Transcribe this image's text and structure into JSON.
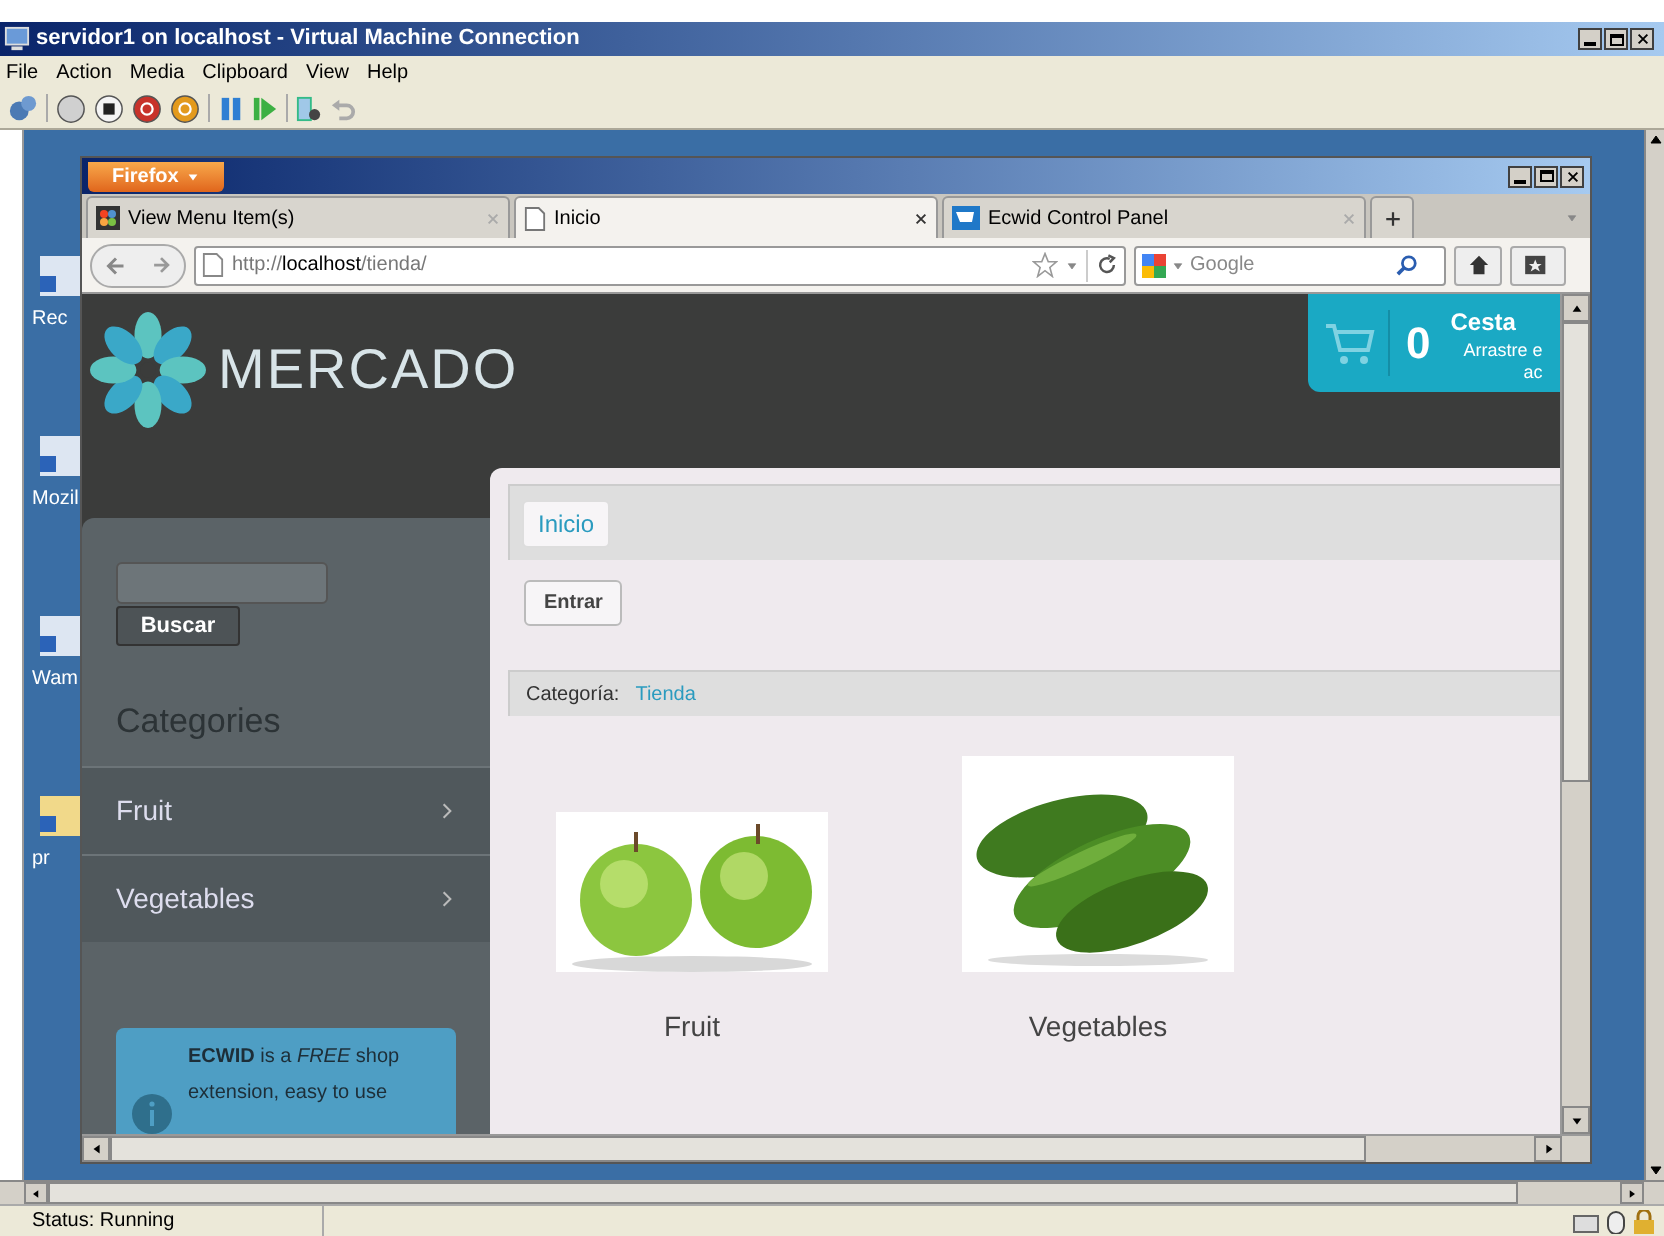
{
  "vm_window": {
    "title": "servidor1 on localhost - Virtual Machine Connection",
    "menu": [
      "File",
      "Action",
      "Media",
      "Clipboard",
      "View",
      "Help"
    ],
    "status": "Status: Running"
  },
  "desktop_icons": [
    {
      "label": "Rec"
    },
    {
      "label": "Mozil"
    },
    {
      "label": "Wam"
    },
    {
      "label": "pr"
    }
  ],
  "browser": {
    "menu_button": "Firefox",
    "tabs": [
      {
        "label": "View Menu Item(s)",
        "selected": false
      },
      {
        "label": "Inicio",
        "selected": true
      },
      {
        "label": "Ecwid Control Panel",
        "selected": false
      }
    ],
    "url": {
      "scheme": "http://",
      "host": "localhost",
      "path": "/tienda/"
    },
    "search_placeholder": "Google"
  },
  "page": {
    "logo": "MERCADO",
    "cart": {
      "count": "0",
      "title": "Cesta",
      "hint_lines": [
        "Arrastre e",
        "ac"
      ]
    },
    "search_button": "Buscar",
    "categories_title": "Categories",
    "categories": [
      {
        "label": "Fruit"
      },
      {
        "label": "Vegetables"
      }
    ],
    "info": [
      "**ECWID** is a *FREE* shop",
      "extension, easy to use"
    ],
    "breadcrumb": "Inicio",
    "login_button": "Entrar",
    "category_label": "Categoría:",
    "category_value": "Tienda",
    "products": [
      {
        "name": "Fruit",
        "kind": "apple"
      },
      {
        "name": "Vegetables",
        "kind": "cucumber"
      }
    ]
  }
}
